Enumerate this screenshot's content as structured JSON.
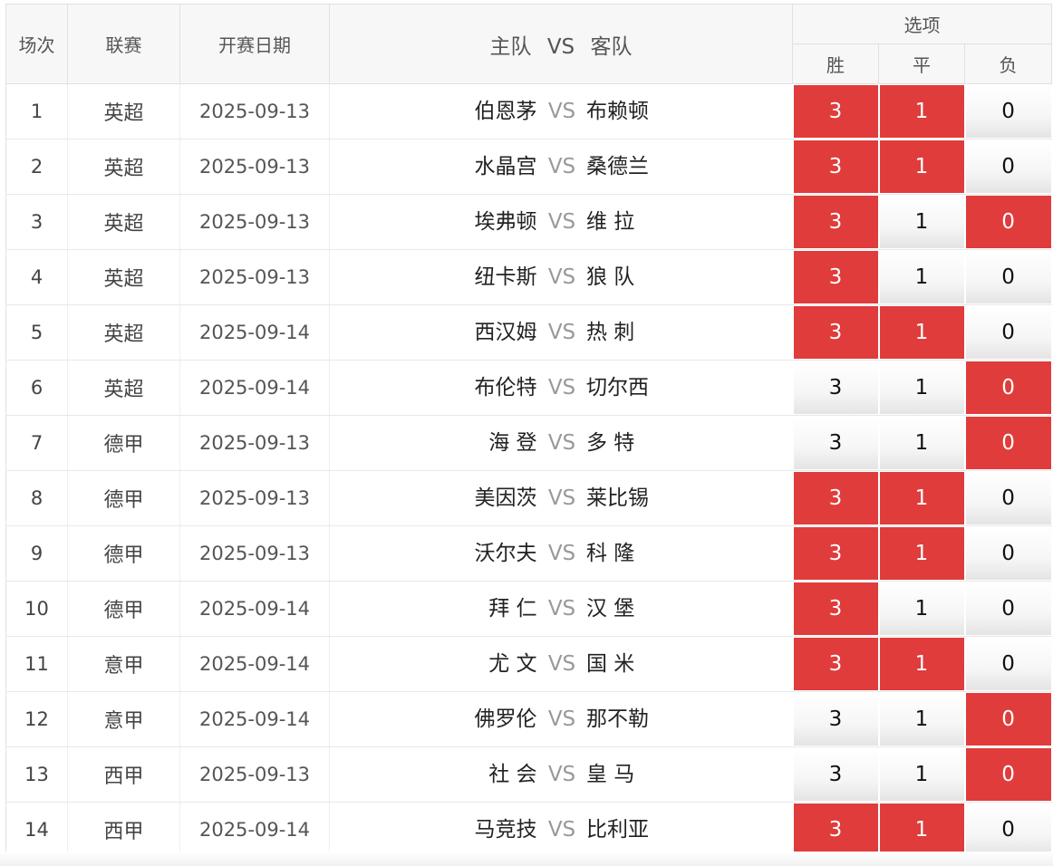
{
  "headers": {
    "idx": "场次",
    "league": "联赛",
    "date": "开赛日期",
    "home": "主队",
    "vs": "VS",
    "away": "客队",
    "options": "选项",
    "win": "胜",
    "draw": "平",
    "lose": "负"
  },
  "colors": {
    "selected": "#e03c3c",
    "header_bg": "#f7f7f7"
  },
  "rows": [
    {
      "idx": "1",
      "league": "英超",
      "date": "2025-09-13",
      "home": "伯恩茅",
      "away": "布赖顿",
      "win": "3",
      "draw": "1",
      "lose": "0",
      "sel": [
        true,
        true,
        false
      ]
    },
    {
      "idx": "2",
      "league": "英超",
      "date": "2025-09-13",
      "home": "水晶宫",
      "away": "桑德兰",
      "win": "3",
      "draw": "1",
      "lose": "0",
      "sel": [
        true,
        true,
        false
      ]
    },
    {
      "idx": "3",
      "league": "英超",
      "date": "2025-09-13",
      "home": "埃弗顿",
      "away": "维 拉",
      "win": "3",
      "draw": "1",
      "lose": "0",
      "sel": [
        true,
        false,
        true
      ]
    },
    {
      "idx": "4",
      "league": "英超",
      "date": "2025-09-13",
      "home": "纽卡斯",
      "away": "狼 队",
      "win": "3",
      "draw": "1",
      "lose": "0",
      "sel": [
        true,
        false,
        false
      ]
    },
    {
      "idx": "5",
      "league": "英超",
      "date": "2025-09-14",
      "home": "西汉姆",
      "away": "热 刺",
      "win": "3",
      "draw": "1",
      "lose": "0",
      "sel": [
        true,
        true,
        false
      ]
    },
    {
      "idx": "6",
      "league": "英超",
      "date": "2025-09-14",
      "home": "布伦特",
      "away": "切尔西",
      "win": "3",
      "draw": "1",
      "lose": "0",
      "sel": [
        false,
        false,
        true
      ]
    },
    {
      "idx": "7",
      "league": "德甲",
      "date": "2025-09-13",
      "home": "海 登",
      "away": "多 特",
      "win": "3",
      "draw": "1",
      "lose": "0",
      "sel": [
        false,
        false,
        true
      ]
    },
    {
      "idx": "8",
      "league": "德甲",
      "date": "2025-09-13",
      "home": "美因茨",
      "away": "莱比锡",
      "win": "3",
      "draw": "1",
      "lose": "0",
      "sel": [
        true,
        true,
        false
      ]
    },
    {
      "idx": "9",
      "league": "德甲",
      "date": "2025-09-13",
      "home": "沃尔夫",
      "away": "科 隆",
      "win": "3",
      "draw": "1",
      "lose": "0",
      "sel": [
        true,
        true,
        false
      ]
    },
    {
      "idx": "10",
      "league": "德甲",
      "date": "2025-09-14",
      "home": "拜 仁",
      "away": "汉 堡",
      "win": "3",
      "draw": "1",
      "lose": "0",
      "sel": [
        true,
        false,
        false
      ]
    },
    {
      "idx": "11",
      "league": "意甲",
      "date": "2025-09-14",
      "home": "尤 文",
      "away": "国 米",
      "win": "3",
      "draw": "1",
      "lose": "0",
      "sel": [
        true,
        true,
        false
      ]
    },
    {
      "idx": "12",
      "league": "意甲",
      "date": "2025-09-14",
      "home": "佛罗伦",
      "away": "那不勒",
      "win": "3",
      "draw": "1",
      "lose": "0",
      "sel": [
        false,
        false,
        true
      ]
    },
    {
      "idx": "13",
      "league": "西甲",
      "date": "2025-09-13",
      "home": "社 会",
      "away": "皇 马",
      "win": "3",
      "draw": "1",
      "lose": "0",
      "sel": [
        false,
        false,
        true
      ]
    },
    {
      "idx": "14",
      "league": "西甲",
      "date": "2025-09-14",
      "home": "马竞技",
      "away": "比利亚",
      "win": "3",
      "draw": "1",
      "lose": "0",
      "sel": [
        true,
        true,
        false
      ]
    }
  ]
}
